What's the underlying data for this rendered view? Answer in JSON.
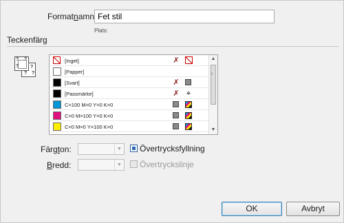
{
  "format_name": {
    "label_pre": "Format",
    "label_u": "n",
    "label_post": "amn:",
    "value": "Fet stil"
  },
  "plats_label": "Plats:",
  "section_title": "Teckenfärg",
  "swatches": [
    {
      "name": "[Inget]",
      "color": "#ffffff",
      "kind": "none"
    },
    {
      "name": "[Papper]",
      "color": "#ffffff",
      "kind": "paper"
    },
    {
      "name": "[Svart]",
      "color": "#000000",
      "kind": "black"
    },
    {
      "name": "[Passmärke]",
      "color": "#000000",
      "kind": "registration"
    },
    {
      "name": "C=100 M=0 Y=0 K=0",
      "color": "#0096d6",
      "kind": "process"
    },
    {
      "name": "C=0 M=100 Y=0 K=0",
      "color": "#e0117f",
      "kind": "process"
    },
    {
      "name": "C=0 M=0 Y=100 K=0",
      "color": "#ffed00",
      "kind": "process"
    }
  ],
  "tint": {
    "label_pre": "Färg",
    "label_u": "t",
    "label_post": "on:",
    "value": ""
  },
  "weight": {
    "label_pre": "",
    "label_u": "B",
    "label_post": "redd:",
    "value": ""
  },
  "overprint_fill": {
    "label": "Övertrycksfyllning",
    "checked": true
  },
  "overprint_stroke": {
    "label": "Övertryckslinje",
    "checked": false,
    "disabled": true
  },
  "buttons": {
    "ok": "OK",
    "cancel": "Avbryt"
  }
}
